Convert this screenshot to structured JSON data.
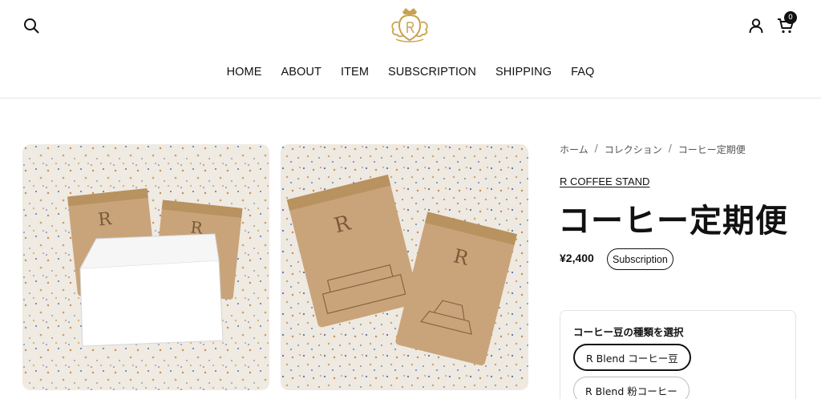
{
  "header": {
    "cart_count": "0",
    "nav": [
      "HOME",
      "ABOUT",
      "ITEM",
      "SUBSCRIPTION",
      "SHIPPING",
      "FAQ"
    ]
  },
  "breadcrumb": [
    "ホーム",
    "コレクション",
    "コーヒー定期便"
  ],
  "breadcrumb_sep": "/",
  "product": {
    "vendor": "R COFFEE STAND",
    "title": "コーヒー定期便",
    "price": "¥2,400",
    "badge": "Subscription",
    "option_label": "コーヒー豆の種類を選択",
    "options": [
      "R Blend コーヒー豆",
      "R Blend 粉コーヒー"
    ]
  },
  "icons": {
    "search": "search-icon",
    "account": "account-icon",
    "cart": "cart-icon",
    "logo": "crest-logo"
  },
  "colors": {
    "text": "#111111",
    "border": "#e6e6e6",
    "logo_gold": "#c9a24e",
    "kraft": "#c9a47a"
  }
}
